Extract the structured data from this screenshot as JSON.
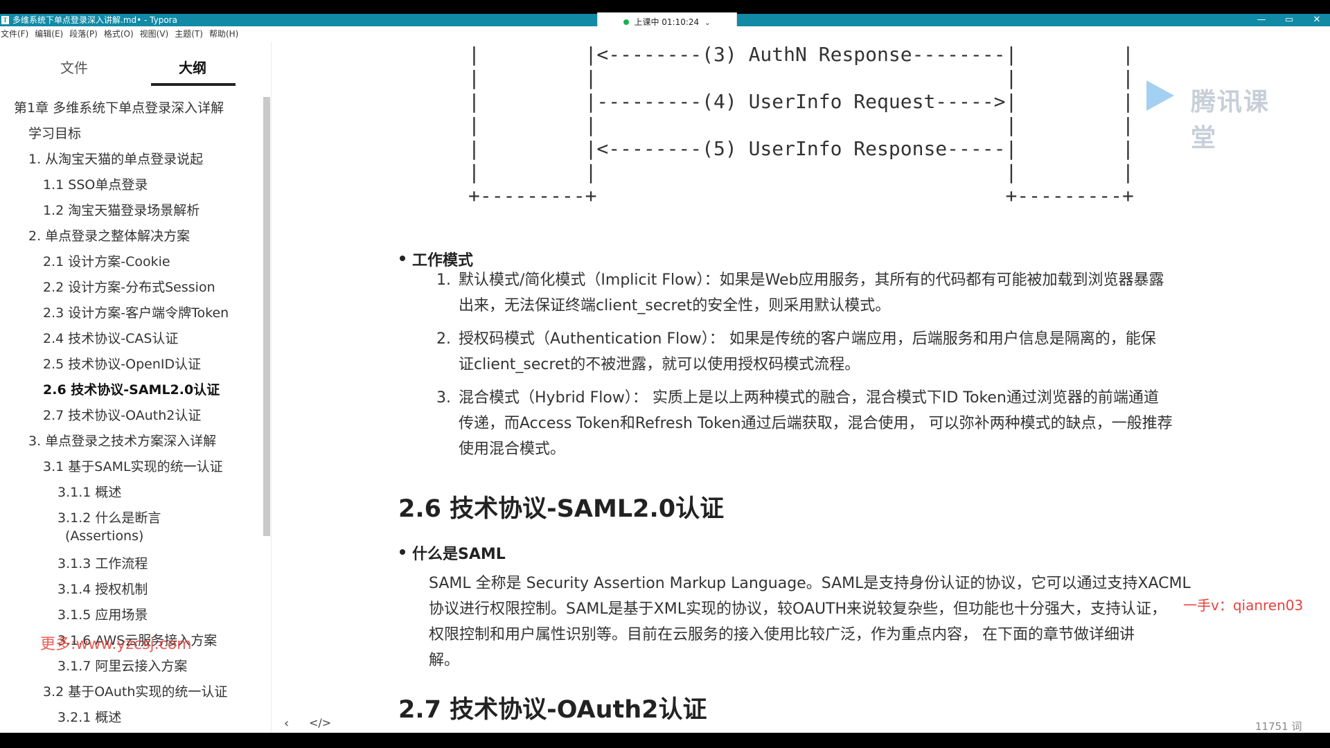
{
  "window": {
    "title": "多维系统下单点登录深入讲解.md• - Typora",
    "controls": [
      "—",
      "▭",
      "✕"
    ]
  },
  "class_status": {
    "label": "上课中 01:10:24",
    "chevron": "⌄"
  },
  "menu": [
    "文件(F)",
    "编辑(E)",
    "段落(P)",
    "格式(O)",
    "视图(V)",
    "主题(T)",
    "帮助(H)"
  ],
  "sidebar": {
    "tab_files": "文件",
    "tab_outline": "大纲",
    "items": [
      {
        "label": "第1章 多维系统下单点登录深入详解"
      },
      {
        "label": "学习目标"
      },
      {
        "label": "1. 从淘宝天猫的单点登录说起"
      },
      {
        "label": "1.1 SSO单点登录"
      },
      {
        "label": "1.2 淘宝天猫登录场景解析"
      },
      {
        "label": "2. 单点登录之整体解决方案"
      },
      {
        "label": "2.1 设计方案-Cookie"
      },
      {
        "label": "2.2 设计方案-分布式Session"
      },
      {
        "label": "2.3 设计方案-客户端令牌Token"
      },
      {
        "label": "2.4 技术协议-CAS认证"
      },
      {
        "label": "2.5 技术协议-OpenID认证"
      },
      {
        "label": "2.6 技术协议-SAML2.0认证"
      },
      {
        "label": "2.7 技术协议-OAuth2认证"
      },
      {
        "label": "3. 单点登录之技术方案深入详解"
      },
      {
        "label": "3.1 基于SAML实现的统一认证"
      },
      {
        "label": "3.1.1 概述"
      },
      {
        "label": "3.1.2 什么是断言"
      },
      {
        "label": "(Assertions)"
      },
      {
        "label": "3.1.3 工作流程"
      },
      {
        "label": "3.1.4 授权机制"
      },
      {
        "label": "3.1.5 应用场景"
      },
      {
        "label": "3.1.6 AWS云服务接入方案"
      },
      {
        "label": "3.1.7 阿里云接入方案"
      },
      {
        "label": "3.2 基于OAuth实现的统一认证"
      },
      {
        "label": "3.2.1 概述"
      }
    ],
    "footer_back": "‹",
    "footer_source": "</>"
  },
  "editor": {
    "code_lines": [
      "|         |<--------(3) AuthN Response--------|         |",
      "|         |                                   |         |",
      "|         |---------(4) UserInfo Request----->|         |",
      "|         |                                   |         |",
      "|         |<--------(5) UserInfo Response-----|         |",
      "|         |                                   |         |",
      "+---------+                                   +---------+"
    ],
    "work_mode_heading": "工作模式",
    "work_modes": [
      {
        "num": "1.",
        "line1": "默认模式/简化模式（Implicit Flow）：如果是Web应用服务，其所有的代码都有可能被加载到浏览器暴露",
        "line2": "出来，无法保证终端client_secret的安全性，则采用默认模式。",
        "line3": ""
      },
      {
        "num": "2.",
        "line1": "授权码模式（Authentication Flow）：  如果是传统的客户端应用，后端服务和用户信息是隔离的，能保",
        "line2": "证client_secret的不被泄露，就可以使用授权码模式流程。",
        "line3": ""
      },
      {
        "num": "3.",
        "line1": "混合模式（Hybrid Flow）：  实质上是以上两种模式的融合，混合模式下ID Token通过浏览器的前端通道",
        "line2": "传递，而Access Token和Refresh Token通过后端获取，混合使用， 可以弥补两种模式的缺点，一般推荐",
        "line3": "使用混合模式。"
      }
    ],
    "saml_title": "2.6 技术协议-SAML2.0认证",
    "saml_bullet": "什么是SAML",
    "saml_para": [
      "SAML 全称是 Security Assertion Markup Language。SAML是支持身份认证的协议，它可以通过支持XACML",
      "协议进行权限控制。SAML是基于XML实现的协议，较OAUTH来说较复杂些，但功能也十分强大，支持认证，",
      "权限控制和用户属性识别等。目前在云服务的接入使用比较广泛，作为重点内容， 在下面的章节做详细讲",
      "解。"
    ],
    "oauth_title": "2.7 技术协议-OAuth2认证",
    "word_count": "11751 词"
  },
  "overlays": {
    "logo_text": "腾讯课堂",
    "watermark_contact": "一手v：qianren03",
    "watermark_site": "更多:www.yzcsj.com"
  },
  "colors": {
    "titlebar": "#118aa6",
    "watermark": "#e8423d",
    "logo": "#c8cfd8"
  }
}
